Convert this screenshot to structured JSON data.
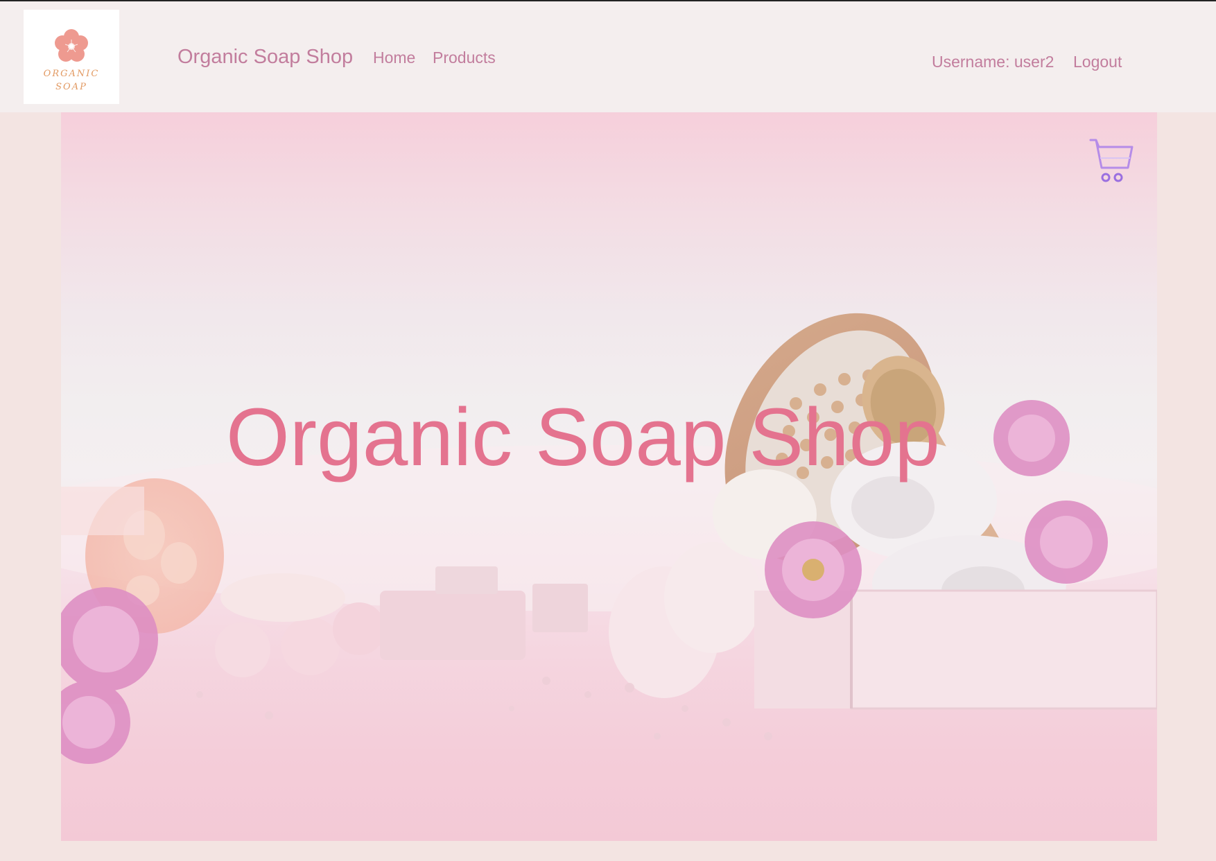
{
  "logo": {
    "line1": "ORGANIC",
    "line2": "SOAP",
    "flower_color": "#ee9a90",
    "text_color": "#e29a63"
  },
  "navbar": {
    "brand": "Organic Soap Shop",
    "links": [
      {
        "label": "Home"
      },
      {
        "label": "Products"
      }
    ],
    "username_label": "Username: user2",
    "logout_label": "Logout",
    "background": "#f4eeee",
    "link_color": "#c27d9d"
  },
  "hero": {
    "title": "Organic Soap Shop",
    "title_color": "#e4738f",
    "cart_icon": "shopping-cart-icon",
    "cart_color": "#a77ee8"
  }
}
